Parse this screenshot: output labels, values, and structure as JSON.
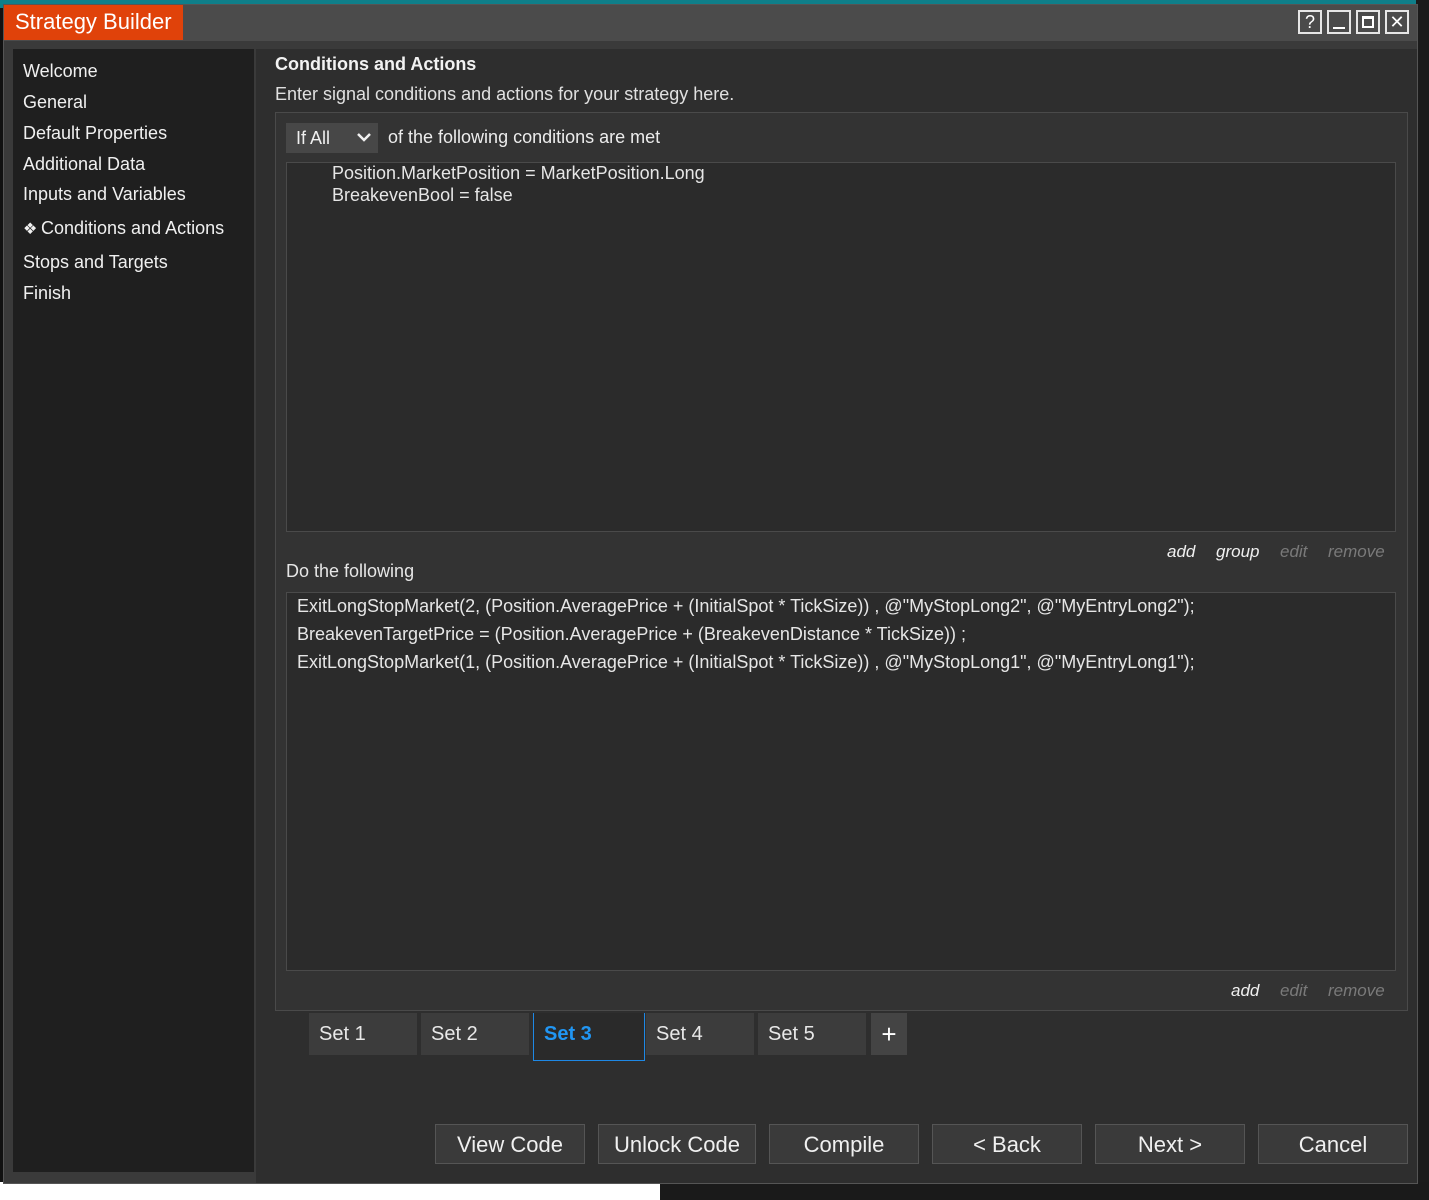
{
  "window": {
    "title": "Strategy Builder",
    "help_symbol": "?",
    "close_symbol": "✕"
  },
  "sidebar": {
    "items": [
      {
        "label": "Welcome"
      },
      {
        "label": "General"
      },
      {
        "label": "Default Properties"
      },
      {
        "label": "Additional Data"
      },
      {
        "label": "Inputs and Variables"
      },
      {
        "label": "Conditions and Actions",
        "bullet": "❖"
      },
      {
        "label": "Stops and Targets"
      },
      {
        "label": "Finish"
      }
    ]
  },
  "main": {
    "title": "Conditions and Actions",
    "subtitle": "Enter signal conditions and actions for your strategy here.",
    "condition_mode": "If All",
    "condition_mode_suffix": "of the following conditions are met",
    "conditions": [
      "Position.MarketPosition = MarketPosition.Long",
      "BreakevenBool = false"
    ],
    "condition_links": {
      "add": "add",
      "group": "group",
      "edit": "edit",
      "remove": "remove"
    },
    "actions_label": "Do the following",
    "actions": [
      "ExitLongStopMarket(2, (Position.AveragePrice + (InitialSpot * TickSize)) , @\"MyStopLong2\", @\"MyEntryLong2\");",
      "BreakevenTargetPrice = (Position.AveragePrice + (BreakevenDistance * TickSize)) ;",
      "ExitLongStopMarket(1, (Position.AveragePrice + (InitialSpot * TickSize)) , @\"MyStopLong1\", @\"MyEntryLong1\");"
    ],
    "action_links": {
      "add": "add",
      "edit": "edit",
      "remove": "remove"
    },
    "tabs": [
      {
        "label": "Set 1"
      },
      {
        "label": "Set 2"
      },
      {
        "label": "Set 3",
        "active": true
      },
      {
        "label": "Set 4"
      },
      {
        "label": "Set 5"
      }
    ],
    "add_tab_symbol": "+"
  },
  "footer": {
    "view_code": "View Code",
    "unlock_code": "Unlock Code",
    "compile": "Compile",
    "back": "< Back",
    "next": "Next >",
    "cancel": "Cancel"
  },
  "colors": {
    "accent_title": "#e0420a",
    "active_tab": "#2196f3"
  }
}
